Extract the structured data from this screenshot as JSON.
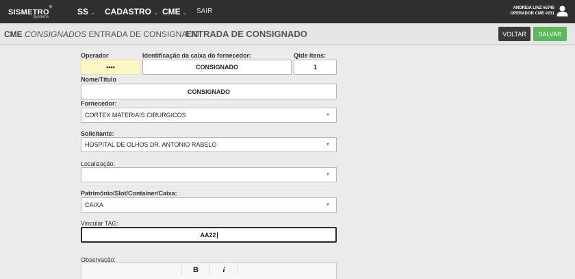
{
  "topbar": {
    "logo_text": "SISMETRO",
    "logo_reg": "®",
    "logo_sub": "Systems",
    "nav": [
      "SS",
      "CADASTRO",
      "CME"
    ],
    "nav_caret": "⌄",
    "sair": "SAIR",
    "user_name": "ANDREIA LINZ #5745",
    "user_role": "OPERADOR CME #231"
  },
  "titlebar": {
    "crumb_module": "CME",
    "crumb_section": "CONSIGNADOS",
    "crumb_page": "ENTRADA DE CONSIGNADO",
    "page_title": "ENTRADA DE CONSIGNADO",
    "voltar": "VOLTAR",
    "salvar": "SALVAR"
  },
  "form": {
    "operador_label": "Operador",
    "operador_value": "••••",
    "ident_label": "Identificação da caixa do fornecedor:",
    "ident_value": "CONSIGNADO",
    "qtde_label": "Qtde itens:",
    "qtde_value": "1",
    "nome_label": "Nome/Título",
    "nome_value": "CONSIGNADO",
    "fornecedor_label": "Fornecedor:",
    "fornecedor_value": "CORTEX MATERIAIS CIRURGICOS",
    "solicitante_label": "Solicitante:",
    "solicitante_value": "HOSPITAL DE OLHOS DR. ANTONIO RABELO",
    "localizacao_label": "Localização:",
    "localizacao_value": "",
    "patrimonio_label": "Patrimônio/Slot/Container/Caixa:",
    "patrimonio_value": "CAIXA",
    "tag_label": "Vincular TAG:",
    "tag_value": "AA22",
    "observacao_label": "Observação:",
    "select_arrow": "▼"
  },
  "editor": {
    "bold": "B",
    "italic": "i"
  }
}
